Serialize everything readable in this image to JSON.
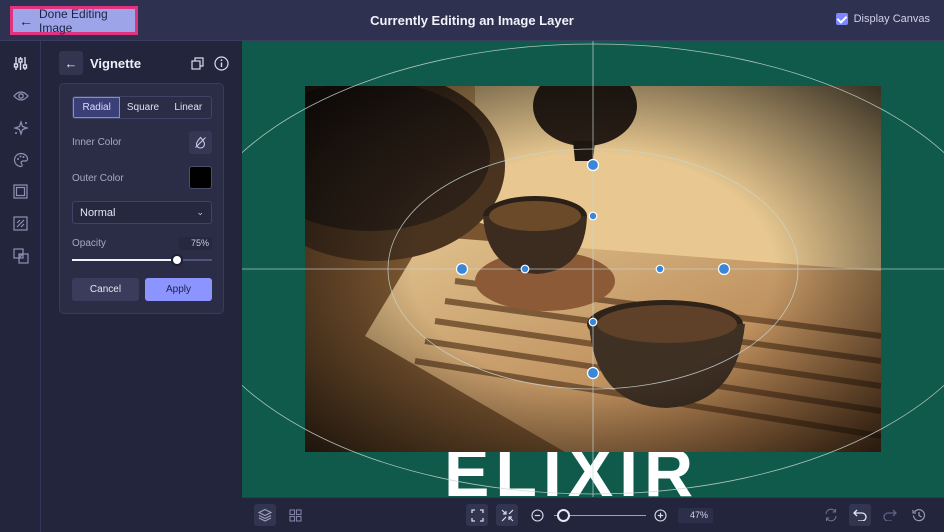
{
  "topbar": {
    "done_label": "Done Editing Image",
    "title": "Currently Editing an Image Layer",
    "display_canvas_label": "Display Canvas",
    "display_canvas_checked": true
  },
  "rail": {
    "icons": [
      "adjust-sliders-icon",
      "eye-icon",
      "sparkle-icon",
      "palette-icon",
      "frame-icon",
      "mask-icon",
      "layers-overlap-icon"
    ]
  },
  "panel": {
    "title": "Vignette",
    "tabs": [
      {
        "label": "Radial",
        "active": true
      },
      {
        "label": "Square",
        "active": false
      },
      {
        "label": "Linear",
        "active": false
      }
    ],
    "inner_color_label": "Inner Color",
    "outer_color_label": "Outer Color",
    "outer_color_value": "#000000",
    "blend_mode": "Normal",
    "opacity_label": "Opacity",
    "opacity_value": "75%",
    "opacity_fraction": 0.75,
    "cancel_label": "Cancel",
    "apply_label": "Apply"
  },
  "canvas": {
    "background_color": "#0f5a4b",
    "text_layer": "ELIXIR"
  },
  "bottombar": {
    "zoom_value": "47%",
    "zoom_fraction": 0.04
  },
  "colors": {
    "accent": "#7d87ff",
    "highlight_border": "#e0337f",
    "handle": "#3a86d8"
  }
}
